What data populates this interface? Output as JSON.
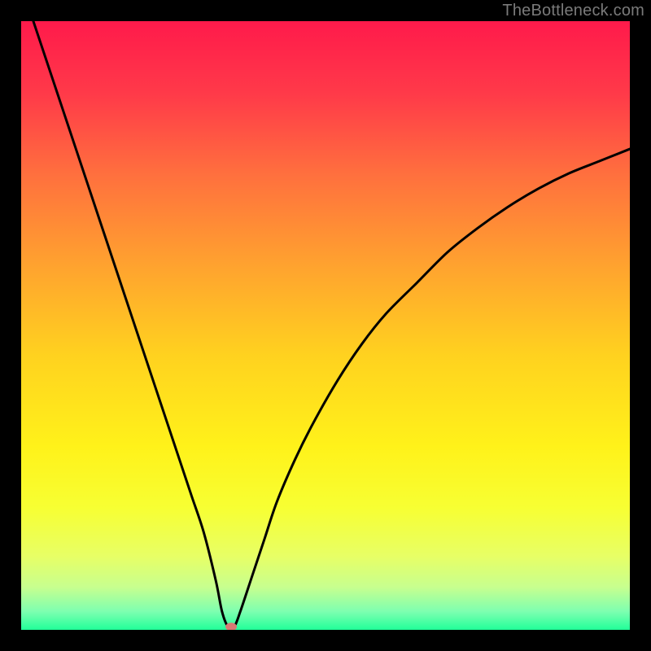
{
  "watermark": "TheBottleneck.com",
  "chart_data": {
    "type": "line",
    "title": "",
    "xlabel": "",
    "ylabel": "",
    "xlim": [
      0,
      100
    ],
    "ylim": [
      0,
      100
    ],
    "grid": false,
    "legend": false,
    "background_gradient": {
      "stops": [
        {
          "offset": 0.0,
          "color": "#ff1a4b"
        },
        {
          "offset": 0.12,
          "color": "#ff3a49"
        },
        {
          "offset": 0.25,
          "color": "#ff6f3e"
        },
        {
          "offset": 0.4,
          "color": "#ffa22f"
        },
        {
          "offset": 0.55,
          "color": "#ffd21f"
        },
        {
          "offset": 0.7,
          "color": "#fff21a"
        },
        {
          "offset": 0.8,
          "color": "#f7ff33"
        },
        {
          "offset": 0.88,
          "color": "#e7ff66"
        },
        {
          "offset": 0.93,
          "color": "#c7ff8f"
        },
        {
          "offset": 0.97,
          "color": "#7dffb0"
        },
        {
          "offset": 1.0,
          "color": "#22ff99"
        }
      ]
    },
    "series": [
      {
        "name": "curve",
        "color": "#000000",
        "x": [
          2,
          4,
          6,
          8,
          10,
          12,
          14,
          16,
          18,
          20,
          22,
          24,
          26,
          28,
          30,
          32,
          33,
          34,
          35,
          36,
          38,
          40,
          42,
          45,
          48,
          52,
          56,
          60,
          65,
          70,
          75,
          80,
          85,
          90,
          95,
          100
        ],
        "y": [
          100,
          94,
          88,
          82,
          76,
          70,
          64,
          58,
          52,
          46,
          40,
          34,
          28,
          22,
          16,
          8,
          3,
          0.5,
          0.5,
          3,
          9,
          15,
          21,
          28,
          34,
          41,
          47,
          52,
          57,
          62,
          66,
          69.5,
          72.5,
          75,
          77,
          79
        ]
      }
    ],
    "marker": {
      "name": "min-point",
      "x": 34.5,
      "y": 0.5,
      "color": "#d97a74",
      "rx": 7,
      "ry": 5
    }
  }
}
